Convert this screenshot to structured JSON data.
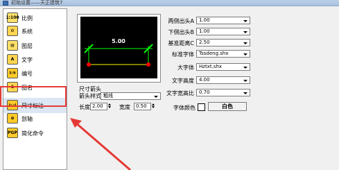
{
  "window": {
    "title": "初始设置——天正建筑7"
  },
  "sidebar": {
    "items": [
      {
        "label": "比例",
        "icon": "scale-icon",
        "icon_text": "1:100",
        "color": "#ffe066"
      },
      {
        "label": "系统",
        "icon": "gear-icon",
        "icon_text": "⚙",
        "color": "#ffd54f"
      },
      {
        "label": "图层",
        "icon": "layers-icon",
        "icon_text": "▤",
        "color": "#ffe066"
      },
      {
        "label": "文字",
        "icon": "text-icon",
        "icon_text": "A",
        "color": "#ffd54f"
      },
      {
        "label": "编号",
        "icon": "numbering-icon",
        "icon_text": "①⑨",
        "color": "#ffca28"
      },
      {
        "label": "图名",
        "icon": "drawing-name-icon",
        "icon_text": "1",
        "color": "#ffd54f"
      },
      {
        "label": "尺寸标注",
        "icon": "dimension-icon",
        "icon_text": "⊢⊣",
        "color": "#ffca28"
      },
      {
        "label": "剖轴",
        "icon": "section-axis-icon",
        "icon_text": "⊕",
        "color": "#ffca28"
      },
      {
        "label": "简化命令",
        "icon": "pgp-icon",
        "icon_text": "PGP",
        "color": "#ffca28"
      }
    ],
    "selected_index": 6
  },
  "preview": {
    "dimension_value": "5.00"
  },
  "arrow": {
    "header": "尺寸箭头",
    "style_label": "箭头样式",
    "style_value": "粗线",
    "length_label": "长度",
    "length_value": "2.00",
    "width_label": "宽度",
    "width_value": "0.50"
  },
  "settings": [
    {
      "label": "两侧出头A",
      "value": "1.00",
      "name": "both-side-extension-field"
    },
    {
      "label": "下侧出头B",
      "value": "1.00",
      "name": "bottom-extension-field"
    },
    {
      "label": "基准距离C",
      "value": "2.50",
      "name": "base-distance-field"
    },
    {
      "label": "标准字体",
      "value": "Tssdeng.shx",
      "name": "standard-font-select"
    },
    {
      "label": "大字体",
      "value": "Hztxt.shx",
      "name": "big-font-select"
    },
    {
      "label": "文字高度",
      "value": "4.00",
      "name": "text-height-field"
    },
    {
      "label": "文字宽高比",
      "value": "0.70",
      "name": "text-aspect-field"
    }
  ],
  "text_color": {
    "label": "字体颜色",
    "value": "白色",
    "swatch": "#ffffff"
  },
  "colors": {
    "highlight": "#e53935",
    "dim_line": "#00ff00",
    "dim_dot": "#ff0000",
    "canvas": "#000000"
  }
}
